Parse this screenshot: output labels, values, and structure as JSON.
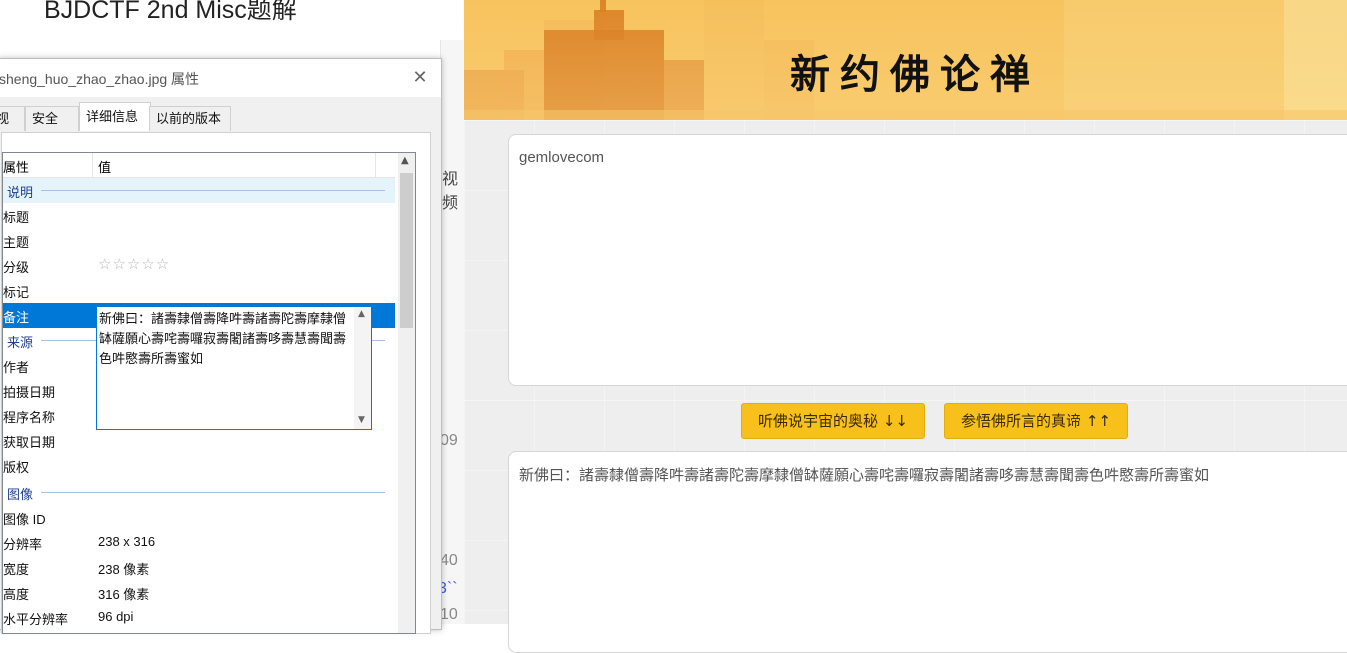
{
  "blog": {
    "title": "BJDCTF 2nd Misc题解",
    "peek_1": "视频",
    "peek_2": "09",
    "peek_3": "40",
    "peek_4": "3``",
    "peek_5": "10"
  },
  "dialog": {
    "title": "sheng_huo_zhao_zhao.jpg 属性",
    "close_glyph": "✕",
    "tabs": [
      "视",
      "安全",
      "详细信息",
      "以前的版本"
    ],
    "columns": {
      "property": "属性",
      "value": "值"
    },
    "rows": [
      {
        "key": "说明",
        "group": true
      },
      {
        "key": "标题",
        "value": ""
      },
      {
        "key": "主题",
        "value": ""
      },
      {
        "key": "分级",
        "value": "☆☆☆☆☆"
      },
      {
        "key": "标记",
        "value": ""
      },
      {
        "key": "备注",
        "value": "",
        "selected": true
      },
      {
        "key": "来源",
        "group": true
      },
      {
        "key": "作者",
        "value": ""
      },
      {
        "key": "拍摄日期",
        "value": ""
      },
      {
        "key": "程序名称",
        "value": ""
      },
      {
        "key": "获取日期",
        "value": ""
      },
      {
        "key": "版权",
        "value": ""
      },
      {
        "key": "图像",
        "group": true
      },
      {
        "key": "图像 ID",
        "value": ""
      },
      {
        "key": "分辨率",
        "value": "238 x 316"
      },
      {
        "key": "宽度",
        "value": "238 像素"
      },
      {
        "key": "高度",
        "value": "316 像素"
      },
      {
        "key": "水平分辨率",
        "value": "96 dpi"
      }
    ],
    "comment_text": "新佛曰：諸壽隸僧壽降吽壽諸壽陀壽摩隸僧缽薩願心壽咤壽囉寂壽闍諸壽哆壽慧壽聞壽色吽愍壽所壽蜜如"
  },
  "app": {
    "banner_title": "新约佛论禅",
    "input_value": "gemlovecom",
    "btn_listen": "听佛说宇宙的奥秘 ↓↓",
    "btn_reveal": "参悟佛所言的真谛 ↑↑",
    "output_value": "新佛曰：諸壽隸僧壽降吽壽諸壽陀壽摩隸僧缽薩願心壽咤壽囉寂壽闍諸壽哆壽慧壽聞壽色吽愍壽所壽蜜如"
  },
  "colors": {
    "accent_button": "#f7c01a",
    "selection": "#0078d7",
    "banner": "#f6b24c"
  }
}
